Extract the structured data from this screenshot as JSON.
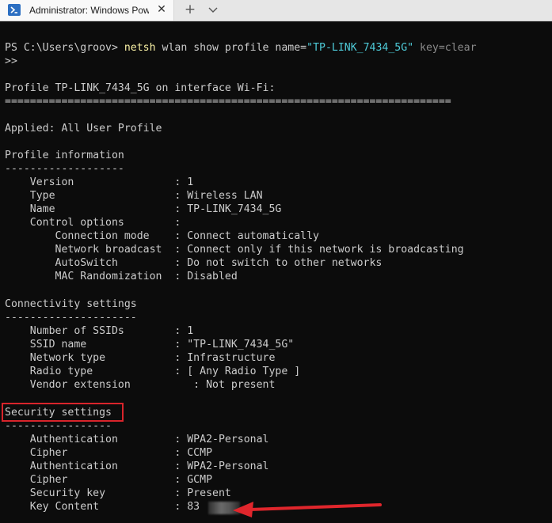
{
  "tab": {
    "title": "Administrator: Windows PowerS",
    "close_glyph": "✕",
    "new_tab_glyph": "+"
  },
  "terminal": {
    "prompt": "PS C:\\Users\\groov> ",
    "command": "netsh",
    "args_plain": " wlan show profile name=",
    "args_string": "\"TP-LINK_7434_5G\"",
    "args_tail": " key=clear",
    "continuation": ">>",
    "profile_header": "Profile TP-LINK_7434_5G on interface Wi-Fi:",
    "profile_rule": "=======================================================================",
    "applied": "Applied: All User Profile",
    "sections": {
      "profile_information": {
        "title": "Profile information",
        "rule": "-------------------",
        "rows": [
          "    Version                : 1",
          "    Type                   : Wireless LAN",
          "    Name                   : TP-LINK_7434_5G",
          "    Control options        :",
          "        Connection mode    : Connect automatically",
          "        Network broadcast  : Connect only if this network is broadcasting",
          "        AutoSwitch         : Do not switch to other networks",
          "        MAC Randomization  : Disabled"
        ]
      },
      "connectivity_settings": {
        "title": "Connectivity settings",
        "rule": "---------------------",
        "rows": [
          "    Number of SSIDs        : 1",
          "    SSID name              : \"TP-LINK_7434_5G\"",
          "    Network type           : Infrastructure",
          "    Radio type             : [ Any Radio Type ]",
          "    Vendor extension          : Not present"
        ]
      },
      "security_settings": {
        "title": "Security settings",
        "rule": "-----------------",
        "rows": [
          "    Authentication         : WPA2-Personal",
          "    Cipher                 : CCMP",
          "    Authentication         : WPA2-Personal",
          "    Cipher                 : GCMP",
          "    Security key           : Present",
          "    Key Content            : 83"
        ]
      }
    }
  },
  "annotation": {
    "highlight_color": "#d9242b",
    "arrow_color": "#e0262c"
  }
}
